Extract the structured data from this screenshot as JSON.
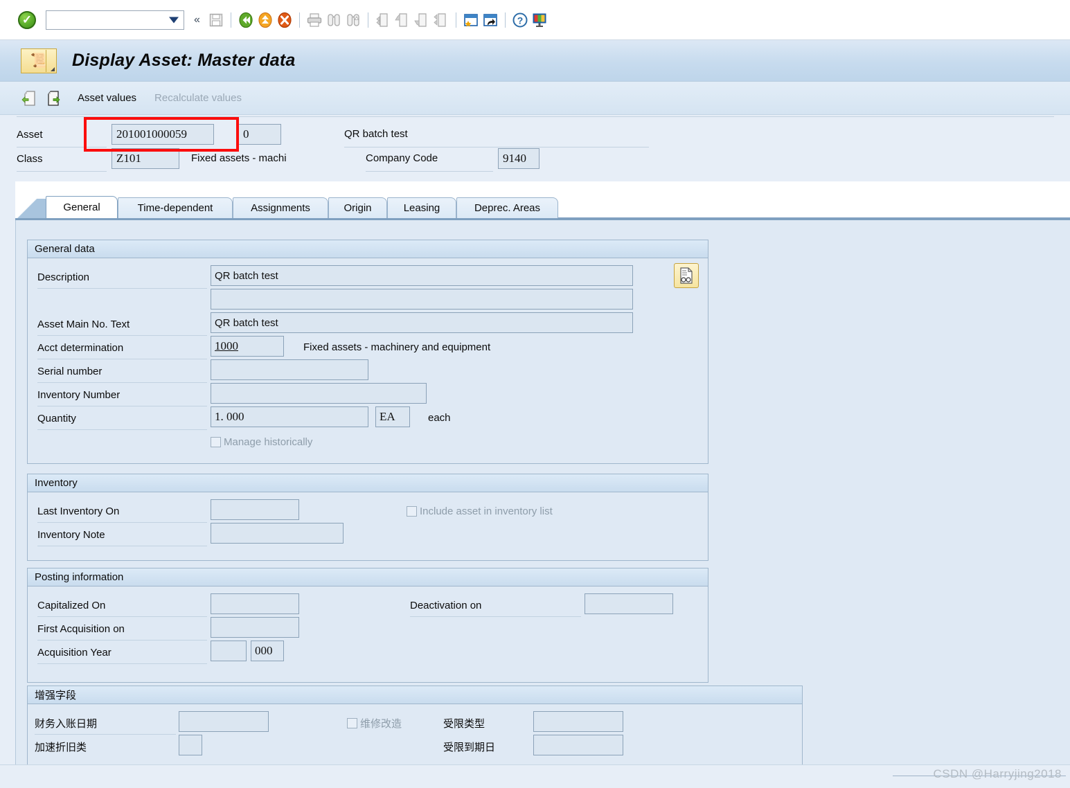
{
  "toolbar": {
    "ok_icon": "green-check-icon",
    "command_value": "",
    "command_placeholder": "",
    "buttons": [
      {
        "name": "back-chevron-icon",
        "label": "«"
      },
      {
        "name": "save-icon",
        "label": "Save"
      },
      {
        "name": "back-green-icon",
        "label": "Back"
      },
      {
        "name": "exit-yellow-icon",
        "label": "Exit"
      },
      {
        "name": "cancel-red-icon",
        "label": "Cancel"
      },
      {
        "name": "print-icon",
        "label": "Print"
      },
      {
        "name": "find-icon",
        "label": "Find"
      },
      {
        "name": "find-next-icon",
        "label": "Find Next"
      },
      {
        "name": "first-page-icon",
        "label": "First Page"
      },
      {
        "name": "previous-page-icon",
        "label": "Previous Page"
      },
      {
        "name": "next-page-icon",
        "label": "Next Page"
      },
      {
        "name": "last-page-icon",
        "label": "Last Page"
      },
      {
        "name": "create-session-icon",
        "label": "Create New Session"
      },
      {
        "name": "create-shortcut-icon",
        "label": "Create Shortcut"
      },
      {
        "name": "help-icon",
        "label": "Help"
      },
      {
        "name": "customize-layout-icon",
        "label": "Customize Local Layout"
      }
    ]
  },
  "title": {
    "text": "Display Asset:  Master data",
    "icon": "asset-master-record-icon"
  },
  "apptoolbar": {
    "prev_asset_icon": "previous-asset-icon",
    "next_asset_icon": "next-asset-icon",
    "asset_values_label": "Asset values",
    "recalculate_label": "Recalculate values"
  },
  "header": {
    "asset_label": "Asset",
    "asset_number": "201001000059",
    "asset_subnumber": "0",
    "asset_description": "QR batch test",
    "class_label": "Class",
    "class_value": "Z101",
    "class_text": "Fixed assets - machi",
    "company_code_label": "Company Code",
    "company_code_value": "9140",
    "highlight_color": "#fb0d0d"
  },
  "tabs": [
    {
      "label": "General",
      "active": true
    },
    {
      "label": "Time-dependent",
      "active": false
    },
    {
      "label": "Assignments",
      "active": false
    },
    {
      "label": "Origin",
      "active": false
    },
    {
      "label": "Leasing",
      "active": false
    },
    {
      "label": "Deprec. Areas",
      "active": false
    }
  ],
  "general_data": {
    "title": "General data",
    "description_label": "Description",
    "description_value": "QR batch test",
    "description_line2_value": "",
    "long_text_icon": "long-text-icon",
    "asset_main_no_text_label": "Asset Main No. Text",
    "asset_main_no_text_value": "QR batch test",
    "acct_determination_label": "Acct determination",
    "acct_determination_value": "1000",
    "acct_determination_text": "Fixed assets - machinery and equipment",
    "serial_number_label": "Serial number",
    "serial_number_value": "",
    "inventory_number_label": "Inventory Number",
    "inventory_number_value": "",
    "quantity_label": "Quantity",
    "quantity_value": "1. 000",
    "quantity_unit": "EA",
    "quantity_unit_text": "each",
    "manage_historically_label": "Manage historically",
    "manage_historically_checked": false
  },
  "inventory": {
    "title": "Inventory",
    "last_inventory_on_label": "Last Inventory On",
    "last_inventory_on_value": "",
    "include_asset_label": "Include asset in inventory list",
    "include_asset_checked": false,
    "inventory_note_label": "Inventory Note",
    "inventory_note_value": ""
  },
  "posting": {
    "title": "Posting information",
    "capitalized_on_label": "Capitalized On",
    "capitalized_on_value": "",
    "deactivation_on_label": "Deactivation on",
    "deactivation_on_value": "",
    "first_acquisition_on_label": "First Acquisition on",
    "first_acquisition_on_value": "",
    "acquisition_year_label": "Acquisition Year",
    "acquisition_year_value": "",
    "acquisition_period_value": "000"
  },
  "enhancement": {
    "title": "增强字段",
    "fin_posting_date_label": "财务入账日期",
    "fin_posting_date_value": "",
    "repair_rebuild_label": "维修改造",
    "repair_rebuild_checked": false,
    "restricted_type_label": "受限类型",
    "restricted_type_value": "",
    "accel_depreciation_label": "加速折旧类",
    "accel_depreciation_value": "",
    "restricted_expiry_label": "受限到期日",
    "restricted_expiry_value": ""
  },
  "watermark": {
    "text": "CSDN @Harryjing2018"
  }
}
